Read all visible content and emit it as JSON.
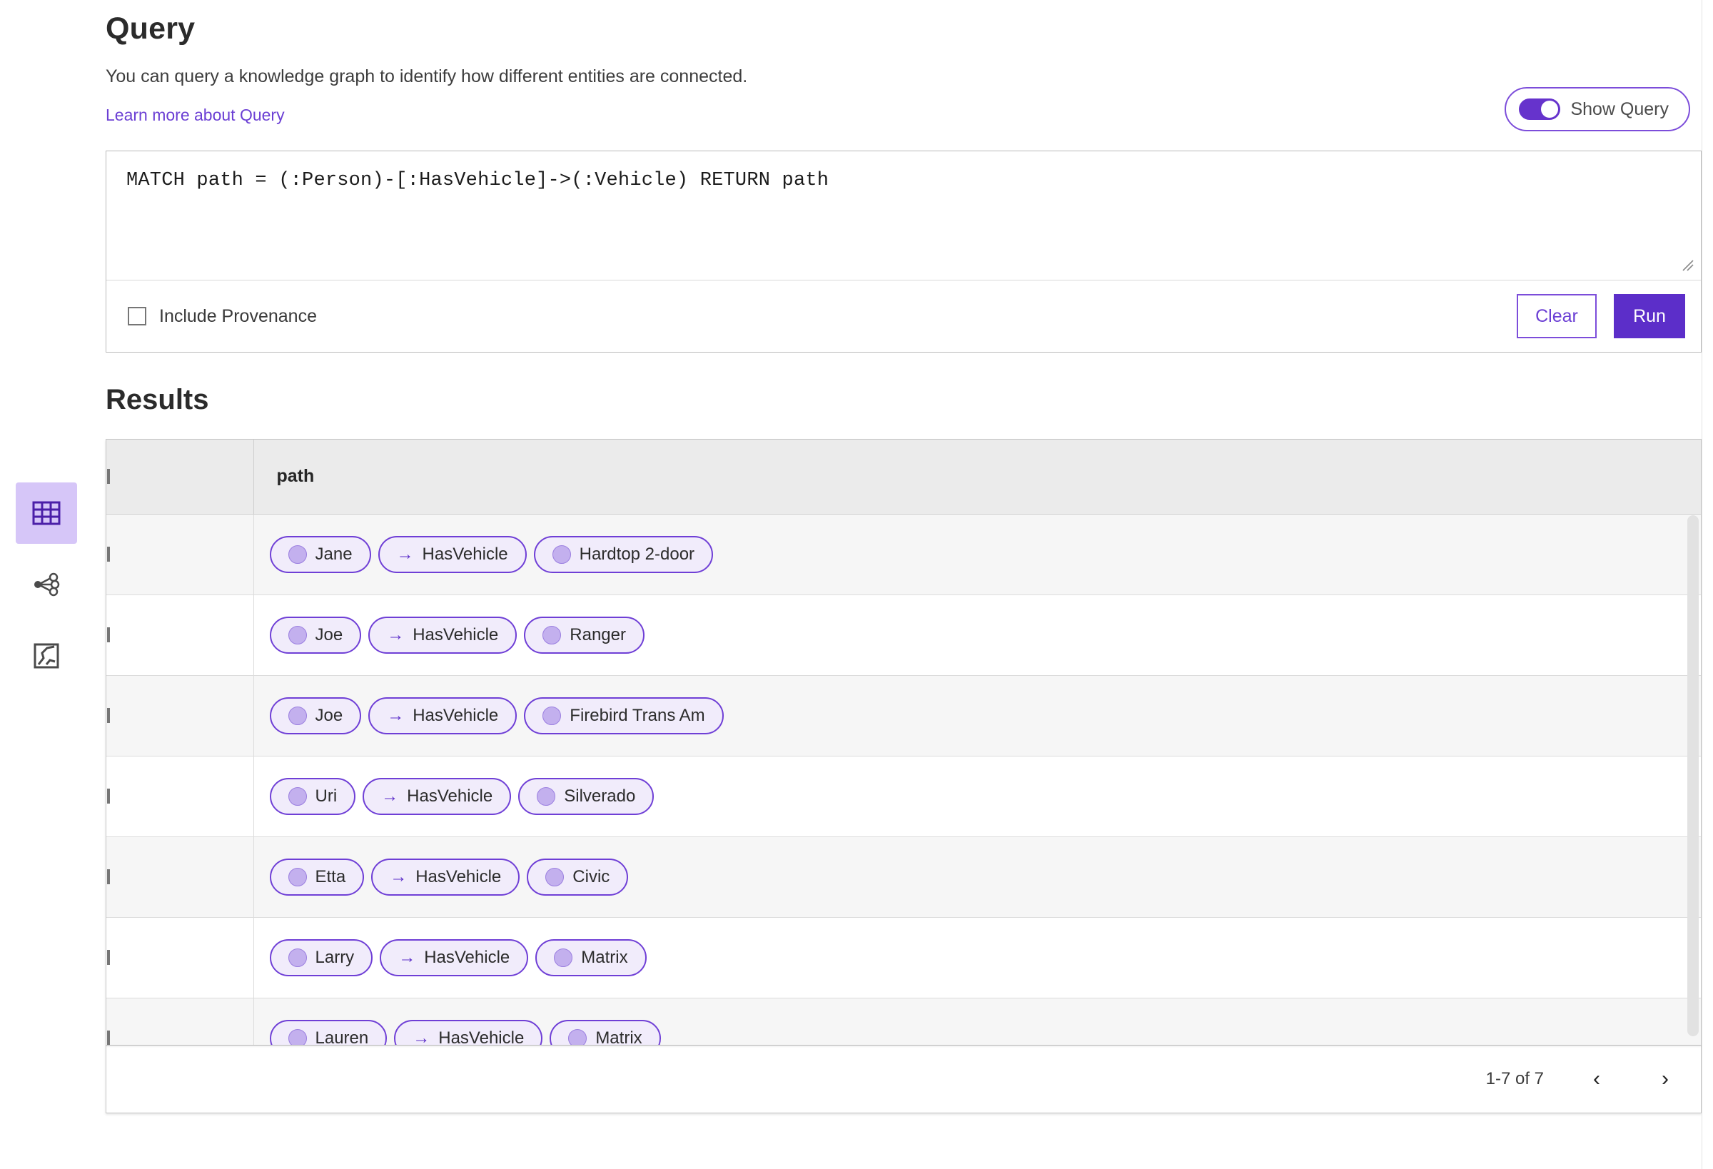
{
  "header": {
    "title": "Query",
    "subtitle": "You can query a knowledge graph to identify how different entities are connected.",
    "learn_more": "Learn more about Query"
  },
  "show_query_toggle": {
    "label": "Show Query",
    "state": "on",
    "accent_color": "#6633cc",
    "border_color": "#7c4dda"
  },
  "editor": {
    "query": "MATCH path = (:Person)-[:HasVehicle]->(:Vehicle) RETURN path",
    "include_provenance_label": "Include Provenance",
    "include_provenance_checked": false,
    "clear_label": "Clear",
    "run_label": "Run"
  },
  "sidebar": {
    "items": [
      {
        "name": "table-view",
        "icon": "table-icon",
        "active": true
      },
      {
        "name": "graph-view",
        "icon": "graph-icon",
        "active": false
      },
      {
        "name": "map-view",
        "icon": "map-icon",
        "active": false
      }
    ]
  },
  "results": {
    "title": "Results",
    "columns": [
      "path"
    ],
    "rows": [
      {
        "source": "Jane",
        "relation": "HasVehicle",
        "target": "Hardtop 2-door"
      },
      {
        "source": "Joe",
        "relation": "HasVehicle",
        "target": "Ranger"
      },
      {
        "source": "Joe",
        "relation": "HasVehicle",
        "target": "Firebird Trans Am"
      },
      {
        "source": "Uri",
        "relation": "HasVehicle",
        "target": "Silverado"
      },
      {
        "source": "Etta",
        "relation": "HasVehicle",
        "target": "Civic"
      },
      {
        "source": "Larry",
        "relation": "HasVehicle",
        "target": "Matrix"
      },
      {
        "source": "Lauren",
        "relation": "HasVehicle",
        "target": "Matrix"
      }
    ],
    "arrow_glyph": "→",
    "pagination": {
      "range_label": "1-7 of 7",
      "prev_glyph": "‹",
      "next_glyph": "›"
    }
  },
  "colors": {
    "accent": "#6633cc",
    "accent_dark": "#5c2ec9",
    "link": "#6b3fd4",
    "chip_bg": "#f1ecfb",
    "chip_border": "#6f3fd6",
    "node_fill": "#c3b0ee",
    "rail_active_bg": "#d6c6f8",
    "header_row_bg": "#ebebeb",
    "odd_row_bg": "#f6f6f6"
  }
}
